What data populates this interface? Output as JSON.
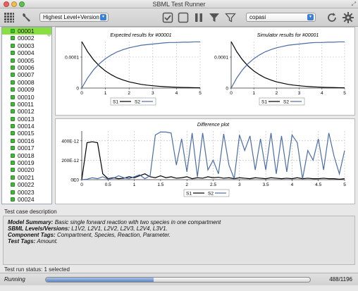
{
  "window": {
    "title": "SBML Test Runner"
  },
  "toolbar": {
    "level_select": "Highest Level+Version",
    "simulator_select": "copasi"
  },
  "test_cases": [
    "00001",
    "00002",
    "00003",
    "00004",
    "00005",
    "00006",
    "00007",
    "00008",
    "00009",
    "00010",
    "00011",
    "00012",
    "00013",
    "00014",
    "00015",
    "00016",
    "00017",
    "00018",
    "00019",
    "00020",
    "00021",
    "00022",
    "00023",
    "00024"
  ],
  "selected_case": "00001",
  "colors": {
    "s1": "#000000",
    "s2": "#4a6da7",
    "selected_row": "#87e03f",
    "case_ok": "#3fba35"
  },
  "description": {
    "header": "Test case description",
    "summary_label": "Model Summary:",
    "summary": "Basic single forward reaction with two species in one compartment",
    "levels_label": "SBML Levels/Versions:",
    "levels": "L1V2, L2V1, L2V2, L2V3, L2V4, L3V1.",
    "ctags_label": "Component Tags:",
    "ctags": "Compartment, Species, Reaction, Parameter.",
    "ttags_label": "Test Tags:",
    "ttags": "Amount."
  },
  "status": {
    "header": "Test run status: 1 selected",
    "state": "Running",
    "progress_text": "488/1196",
    "progress_fraction": 0.408
  },
  "chart_data": [
    {
      "type": "line",
      "title": "Expected results for #00001",
      "x": [
        0,
        0.25,
        0.5,
        0.75,
        1,
        1.25,
        1.5,
        1.75,
        2,
        2.25,
        2.5,
        2.75,
        3,
        3.25,
        3.5,
        3.75,
        4,
        4.25,
        4.5,
        4.75,
        5
      ],
      "series": [
        {
          "name": "S1",
          "values": [
            0.00015,
            0.000117,
            9.1e-05,
            7.1e-05,
            5.5e-05,
            4.3e-05,
            3.3e-05,
            2.6e-05,
            2e-05,
            1.6e-05,
            1.2e-05,
            9.5e-06,
            7.5e-06,
            5.8e-06,
            4.5e-06,
            3.5e-06,
            2.7e-06,
            2.1e-06,
            1.7e-06,
            1.3e-06,
            1e-06
          ]
        },
        {
          "name": "S2",
          "values": [
            0,
            3.3e-05,
            5.9e-05,
            7.9e-05,
            9.5e-05,
            0.000107,
            0.000117,
            0.000124,
            0.00013,
            0.000134,
            0.000138,
            0.00014,
            0.000142,
            0.000144,
            0.000146,
            0.000147,
            0.000147,
            0.000148,
            0.000148,
            0.000149,
            0.000149
          ]
        }
      ],
      "xticks": [
        "0",
        "1",
        "2",
        "3",
        "4",
        "5"
      ],
      "yticks": [
        "0",
        "0.0001"
      ],
      "xlim": [
        0,
        5
      ],
      "ylim": [
        0,
        0.00015
      ],
      "grid": true
    },
    {
      "type": "line",
      "title": "Simulator results for #00001",
      "x": [
        0,
        0.25,
        0.5,
        0.75,
        1,
        1.25,
        1.5,
        1.75,
        2,
        2.25,
        2.5,
        2.75,
        3,
        3.25,
        3.5,
        3.75,
        4,
        4.25,
        4.5,
        4.75,
        5
      ],
      "series": [
        {
          "name": "S1",
          "values": [
            0.00015,
            0.000117,
            9.1e-05,
            7.1e-05,
            5.5e-05,
            4.3e-05,
            3.3e-05,
            2.6e-05,
            2e-05,
            1.6e-05,
            1.2e-05,
            9.5e-06,
            7.5e-06,
            5.8e-06,
            4.5e-06,
            3.5e-06,
            2.7e-06,
            2.1e-06,
            1.7e-06,
            1.3e-06,
            1e-06
          ]
        },
        {
          "name": "S2",
          "values": [
            0,
            3.3e-05,
            5.9e-05,
            7.9e-05,
            9.5e-05,
            0.000107,
            0.000117,
            0.000124,
            0.00013,
            0.000134,
            0.000138,
            0.00014,
            0.000142,
            0.000144,
            0.000146,
            0.000147,
            0.000147,
            0.000148,
            0.000148,
            0.000149,
            0.000149
          ]
        }
      ],
      "xticks": [
        "0",
        "1",
        "2",
        "3",
        "4",
        "5"
      ],
      "yticks": [
        "0",
        "0.0001"
      ],
      "xlim": [
        0,
        5
      ],
      "ylim": [
        0,
        0.00015
      ],
      "grid": true
    },
    {
      "type": "line",
      "title": "Difference plot",
      "x": [
        0,
        0.1,
        0.2,
        0.3,
        0.4,
        0.5,
        0.6,
        0.7,
        0.8,
        0.9,
        1,
        1.1,
        1.2,
        1.3,
        1.4,
        1.5,
        1.6,
        1.7,
        1.8,
        1.9,
        2,
        2.1,
        2.2,
        2.3,
        2.4,
        2.5,
        2.6,
        2.7,
        2.8,
        2.9,
        3,
        3.1,
        3.2,
        3.3,
        3.4,
        3.5,
        3.6,
        3.7,
        3.8,
        3.9,
        4,
        4.1,
        4.2,
        4.3,
        4.4,
        4.5,
        4.6,
        4.7,
        4.8,
        4.9,
        5
      ],
      "series": [
        {
          "name": "S1",
          "values": [
            0,
            380,
            390,
            380,
            60,
            10,
            20,
            10,
            15,
            30,
            20,
            40,
            60,
            30,
            20,
            40,
            20,
            30,
            15,
            20,
            30,
            10,
            20,
            15,
            30,
            20,
            25,
            15,
            20,
            10,
            20,
            15,
            10,
            20,
            15,
            10,
            20,
            15,
            10,
            15,
            10,
            20,
            10,
            15,
            10,
            10,
            15,
            10,
            10,
            5,
            10
          ]
        },
        {
          "name": "S2",
          "values": [
            0,
            5,
            20,
            10,
            30,
            5,
            15,
            40,
            20,
            10,
            30,
            50,
            10,
            40,
            460,
            490,
            490,
            480,
            150,
            420,
            80,
            480,
            30,
            480,
            100,
            200,
            60,
            470,
            150,
            10,
            460,
            300,
            450,
            100,
            420,
            100,
            480,
            60,
            450,
            80,
            460,
            380,
            10,
            300,
            200,
            420,
            100,
            480,
            240,
            60,
            300
          ]
        }
      ],
      "xticks": [
        "0",
        "0.5",
        "1",
        "1.5",
        "2",
        "2.5",
        "3",
        "3.5",
        "4",
        "4.5",
        "5"
      ],
      "yticks": [
        "0E0",
        "200E-12",
        "400E-12"
      ],
      "xlim": [
        0,
        5
      ],
      "ylim": [
        0,
        500
      ],
      "grid": true
    }
  ]
}
